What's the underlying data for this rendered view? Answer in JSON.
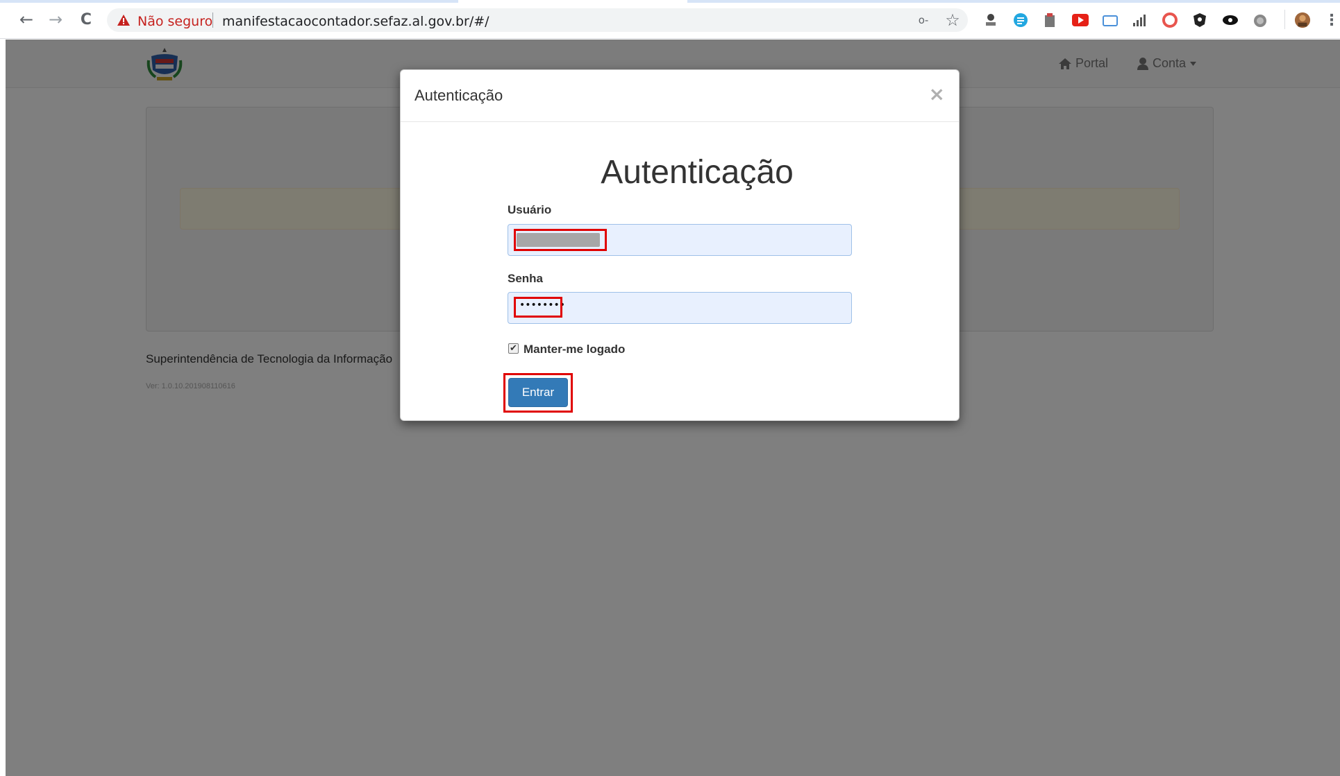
{
  "browser": {
    "security_label": "Não seguro",
    "url": "manifestacaocontador.sefaz.al.gov.br/#/",
    "nav_back": "←",
    "nav_forward": "→",
    "nav_reload": "C",
    "key_glyph": "o‑",
    "star_glyph": "☆",
    "menu_glyph": "⋮"
  },
  "page": {
    "nav_portal": "Portal",
    "nav_account": "Conta",
    "footer_text": "Superintendência de Tecnologia da Informação",
    "version": "Ver: 1.0.10.201908110616"
  },
  "modal": {
    "header_title": "Autenticação",
    "close_glyph": "×",
    "big_title": "Autenticação",
    "username_label": "Usuário",
    "password_label": "Senha",
    "password_mask": "••••••••",
    "remember_label": "Manter-me logado",
    "remember_checked": true,
    "submit_label": "Entrar"
  },
  "colors": {
    "primary_button": "#337ab7",
    "highlight": "#e00000",
    "autofill_bg": "#e8f0fe"
  }
}
